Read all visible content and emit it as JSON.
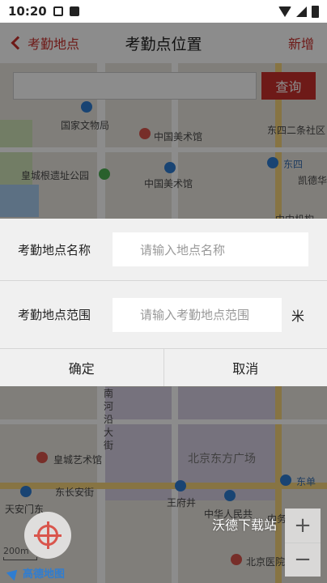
{
  "status_bar": {
    "time": "10:20"
  },
  "header": {
    "back_label": "考勤地点",
    "title": "考勤点位置",
    "add_label": "新增"
  },
  "search": {
    "placeholder": "",
    "button_label": "查询"
  },
  "map_labels": {
    "national_archives": "国家文物局",
    "art_museum_top": "中国美术馆",
    "dongsi_2": "东四二条社区",
    "imperial_park": "皇城根遗址公园",
    "art_museum": "中国美术馆",
    "dongsi": "东四",
    "kaide": "凯德华",
    "zhongzhong": "中中机构",
    "nanheyan": "南河沿大街",
    "imperial_art": "皇城艺术馆",
    "oriental_plaza": "北京东方广场",
    "changan": "东长安街",
    "tiananmen_east": "天安门东",
    "wangfujing": "王府井",
    "dongdan": "东单",
    "people_gov": "中华人民共",
    "neiwu": "内务",
    "hospital": "北京医院",
    "scale": "200m",
    "logo": "高德地图",
    "watermark": "沃德下载站"
  },
  "dialog": {
    "name_label": "考勤地点名称",
    "name_placeholder": "请输入地点名称",
    "range_label": "考勤地点范围",
    "range_placeholder": "请输入考勤地点范围",
    "range_unit": "米",
    "confirm_label": "确定",
    "cancel_label": "取消"
  },
  "colors": {
    "accent": "#c9302c"
  }
}
